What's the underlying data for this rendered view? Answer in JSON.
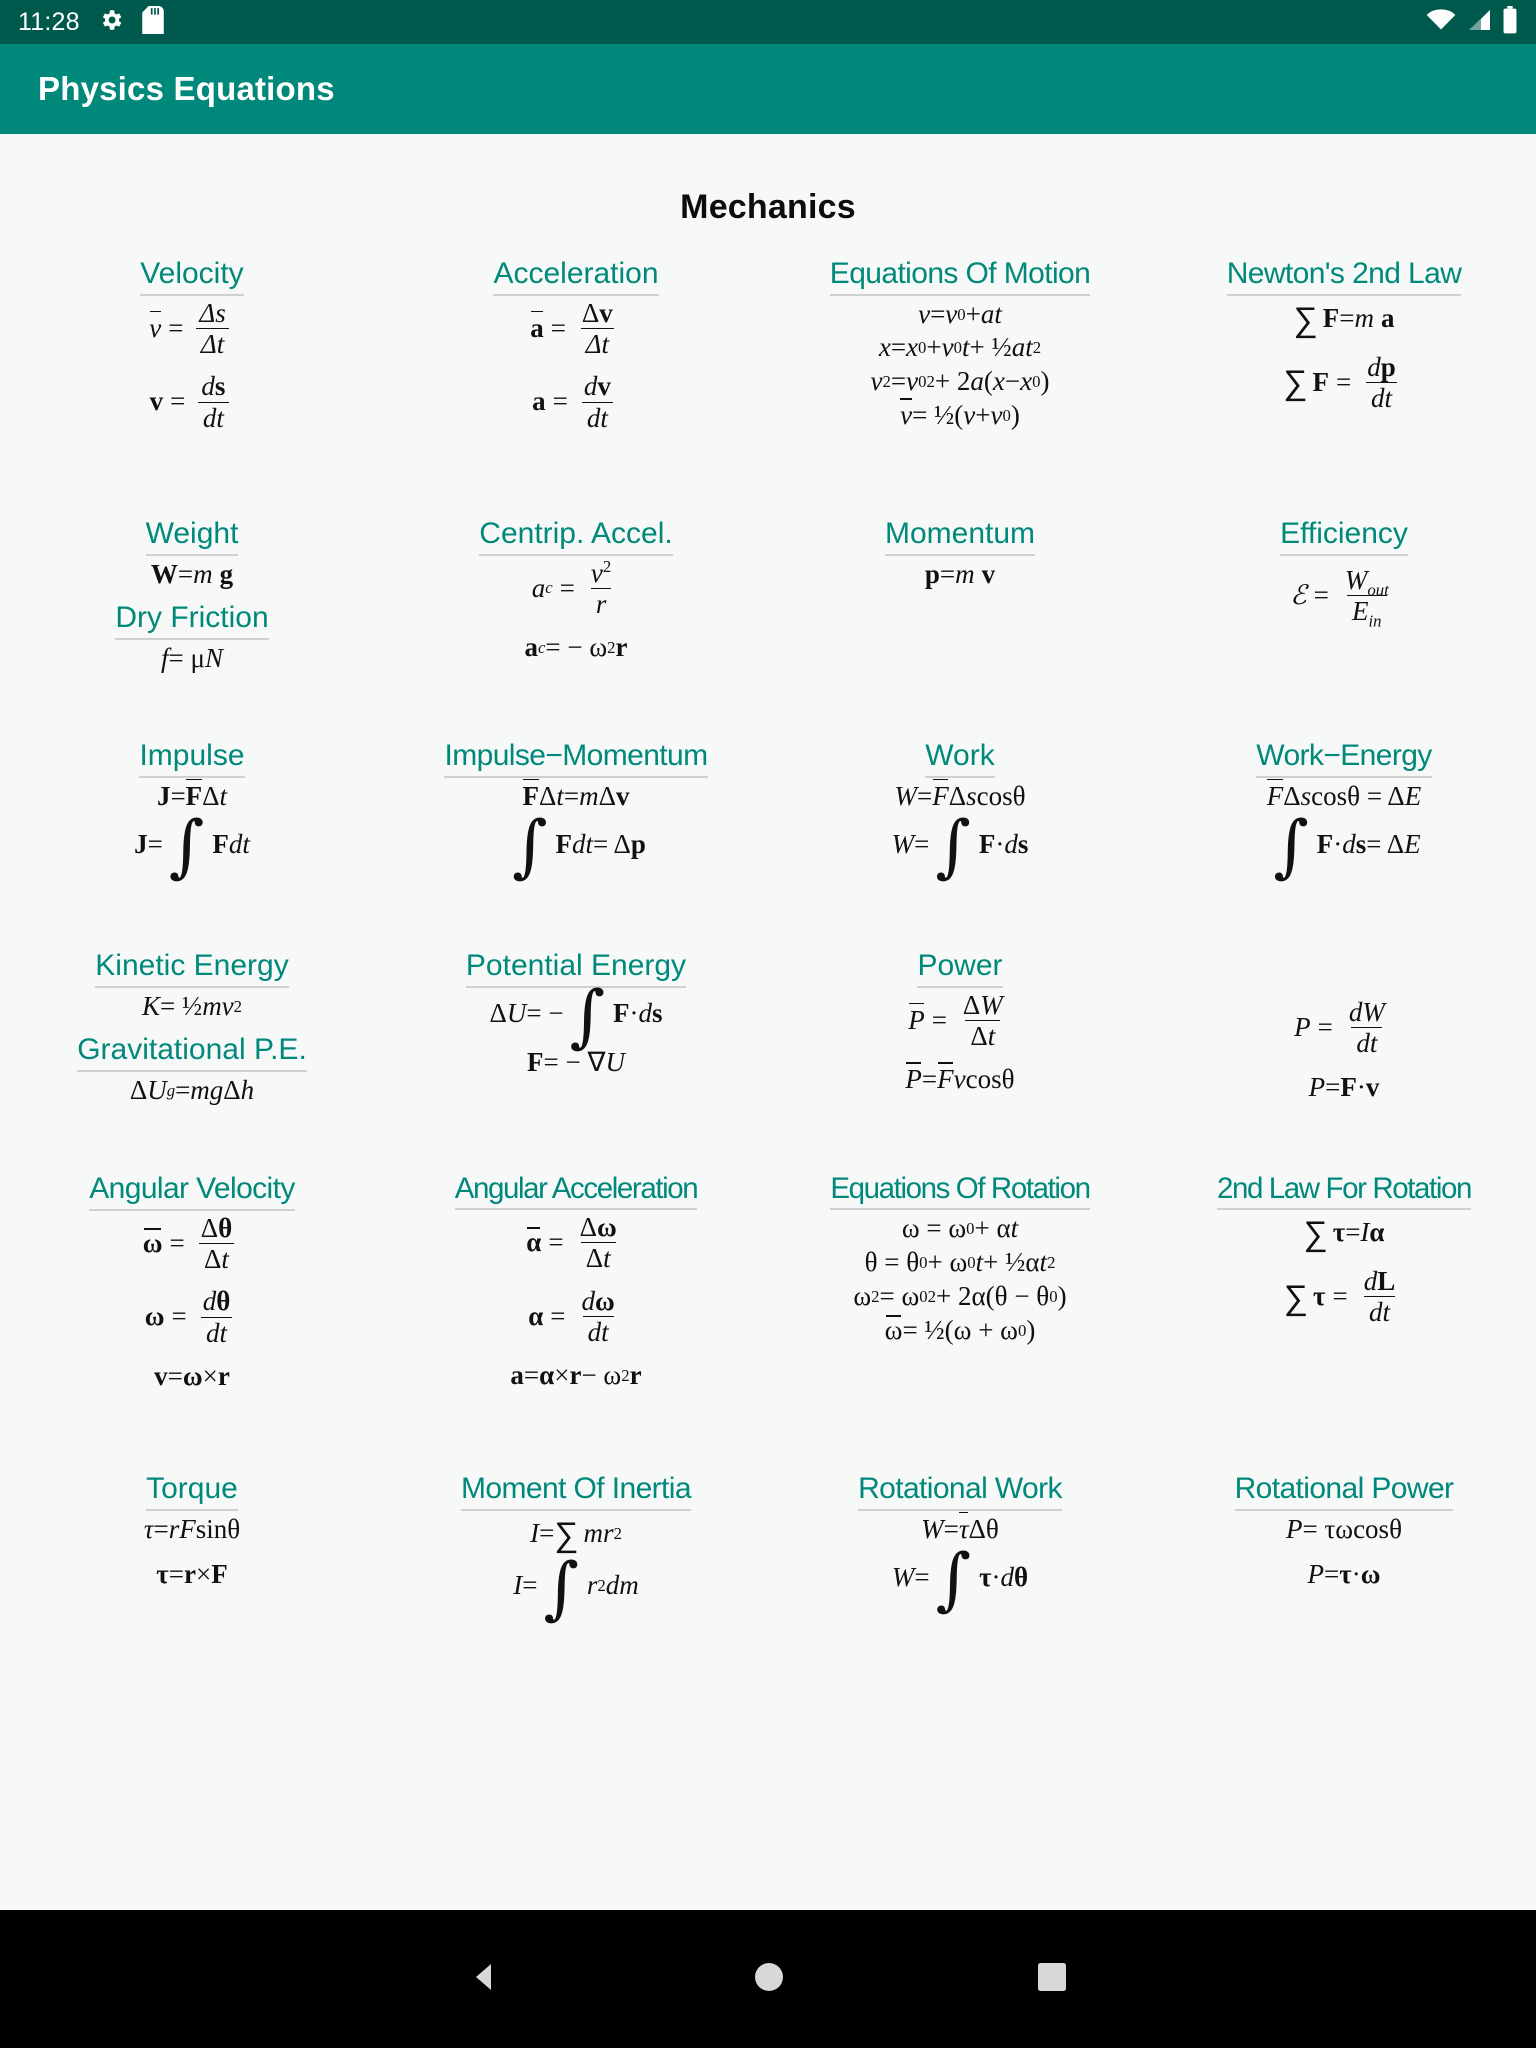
{
  "status_bar": {
    "clock": "11:28",
    "left_icons": [
      "gear-icon",
      "sd-card-icon"
    ],
    "right_icons": [
      "wifi-icon",
      "cellular-signal-icon",
      "battery-icon"
    ],
    "background_color": "#00594d"
  },
  "app_bar": {
    "title": "Physics Equations",
    "background_color": "#00897b"
  },
  "page": {
    "section_title": "Mechanics",
    "accent_color": "#00897b",
    "background_color": "#f7f8f8"
  },
  "cards": {
    "velocity": {
      "title": "Velocity"
    },
    "acceleration": {
      "title": "Acceleration"
    },
    "equations_of_motion": {
      "title": "Equations Of Motion"
    },
    "newtons_2nd_law": {
      "title": "Newton's 2nd Law"
    },
    "weight": {
      "title": "Weight"
    },
    "dry_friction": {
      "title": "Dry Friction"
    },
    "centrip_accel": {
      "title": "Centrip. Accel."
    },
    "momentum": {
      "title": "Momentum"
    },
    "efficiency": {
      "title": "Efficiency"
    },
    "impulse": {
      "title": "Impulse"
    },
    "impulse_momentum": {
      "title": "Impulse−Momentum"
    },
    "work": {
      "title": "Work"
    },
    "work_energy": {
      "title": "Work−Energy"
    },
    "kinetic_energy": {
      "title": "Kinetic Energy"
    },
    "gravitational_pe": {
      "title": "Gravitational P.E."
    },
    "potential_energy": {
      "title": "Potential Energy"
    },
    "power": {
      "title": "Power"
    },
    "angular_velocity": {
      "title": "Angular Velocity"
    },
    "angular_acceleration": {
      "title": "Angular Acceleration"
    },
    "equations_of_rotation": {
      "title": "Equations Of Rotation"
    },
    "second_law_rotation": {
      "title": "2nd Law For Rotation"
    },
    "torque": {
      "title": "Torque"
    },
    "moment_of_inertia": {
      "title": "Moment Of Inertia"
    },
    "rotational_work": {
      "title": "Rotational Work"
    },
    "rotational_power": {
      "title": "Rotational Power"
    }
  },
  "formulas": {
    "velocity": [
      "v̄ = Δs / Δt",
      "v = ds / dt"
    ],
    "acceleration": [
      "ā = Δv / Δt",
      "a = dv / dt"
    ],
    "equations_of_motion": [
      "v = v₀ + at",
      "x = x₀ + v₀t + ½at²",
      "v² = v₀² + 2a(x − x₀)",
      "v̄ = ½(v + v₀)"
    ],
    "newtons_2nd_law": [
      "∑ F = m a",
      "∑ F = dp / dt"
    ],
    "weight": [
      "W = m g"
    ],
    "dry_friction": [
      "f = μN"
    ],
    "centrip_accel": [
      "a_c = v² / r",
      "a_c = − ω² r"
    ],
    "momentum": [
      "p = m v"
    ],
    "efficiency": [
      "ℰ = W_out / E_in"
    ],
    "impulse": [
      "J = F̄ Δt",
      "J = ∫ F dt"
    ],
    "impulse_momentum": [
      "F̄ Δt = m Δv",
      "∫ F dt = Δp"
    ],
    "work": [
      "W = F̄Δs cos θ",
      "W = ∫ F · ds"
    ],
    "work_energy": [
      "F̄Δs cos θ = ΔE",
      "∫ F · ds = ΔE"
    ],
    "kinetic_energy": [
      "K = ½mv²"
    ],
    "gravitational_pe": [
      "ΔU_g = mgΔh"
    ],
    "potential_energy": [
      "ΔU = − ∫ F · ds",
      "F = − ∇U"
    ],
    "power": [
      "P̄ = ΔW / Δt",
      "P̄ = F̄v cos θ"
    ],
    "power_right": [
      "P = dW / dt",
      "P = F · v"
    ],
    "angular_velocity": [
      "ω̄ = Δθ / Δt",
      "ω = dθ / dt",
      "v = ω × r"
    ],
    "angular_acceleration": [
      "ᾱ = Δω / Δt",
      "α = dω / dt",
      "a = α × r − ω² r"
    ],
    "equations_of_rotation": [
      "ω = ω₀ + αt",
      "θ = θ₀ + ω₀t + ½αt²",
      "ω² = ω₀² + 2α(θ − θ₀)",
      "ω̄ = ½(ω + ω₀)"
    ],
    "second_law_rotation": [
      "∑ τ = I α",
      "∑ τ = dL / dt"
    ],
    "torque": [
      "τ = rF sin θ",
      "τ = r × F"
    ],
    "moment_of_inertia": [
      "I = ∑ mr²",
      "I = ∫ r² dm"
    ],
    "rotational_work": [
      "W = τ̄Δθ",
      "W = ∫ τ · dθ"
    ],
    "rotational_power": [
      "P = τω cos θ",
      "P = τ · ω"
    ]
  },
  "nav_bar": {
    "buttons": [
      "back-triangle-icon",
      "home-circle-icon",
      "recents-square-icon"
    ],
    "background_color": "#000000"
  }
}
